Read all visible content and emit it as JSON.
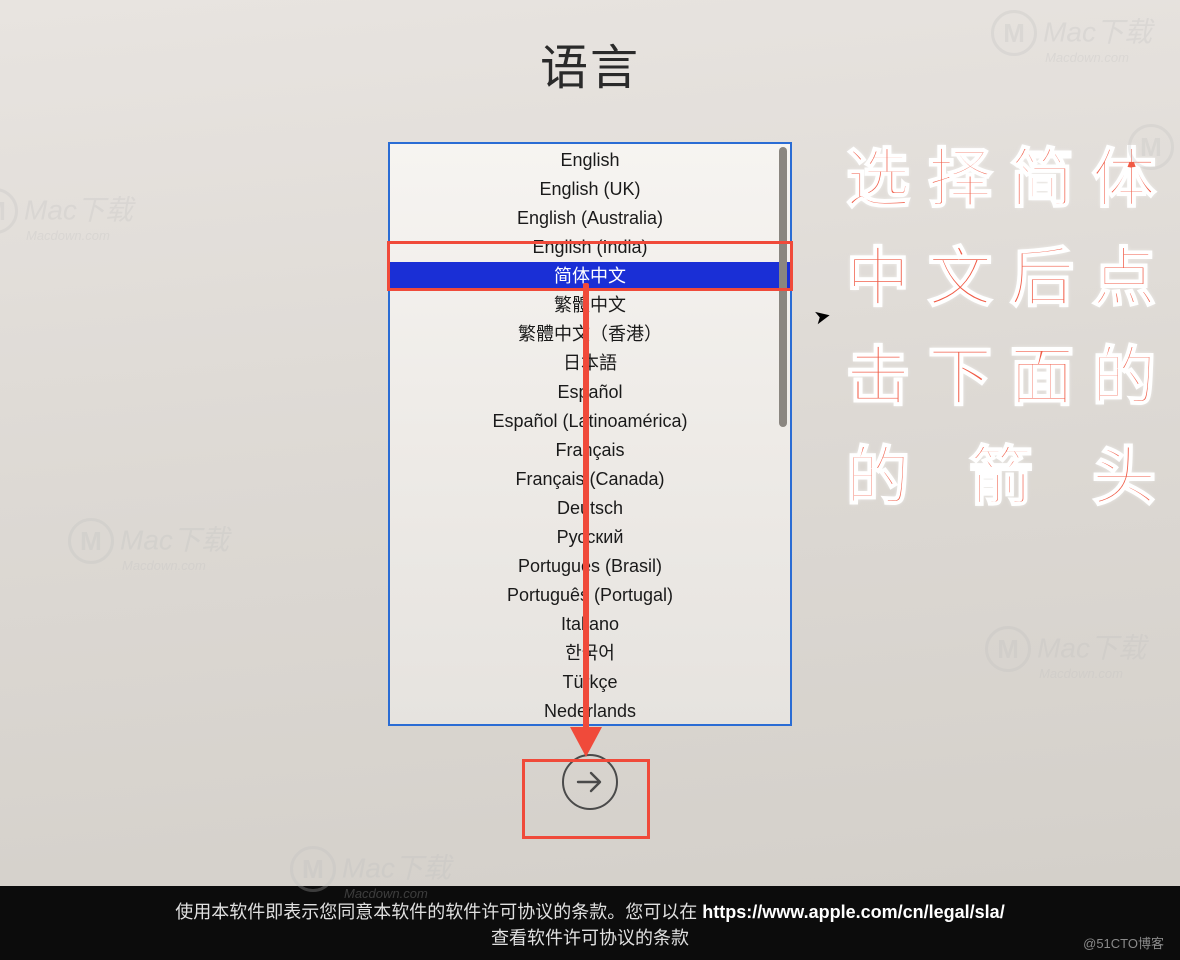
{
  "title": "语言",
  "languages": [
    "English",
    "English (UK)",
    "English (Australia)",
    "English (India)",
    "简体中文",
    "繁體中文",
    "繁體中文（香港）",
    "日本語",
    "Español",
    "Español (Latinoamérica)",
    "Français",
    "Français (Canada)",
    "Deutsch",
    "Русский",
    "Português (Brasil)",
    "Português (Portugal)",
    "Italiano",
    "한국어",
    "Türkçe",
    "Nederlands"
  ],
  "selected_index": 4,
  "callout_lines": [
    "选择简体",
    "中文后点",
    "击下面的",
    "的箭头"
  ],
  "footer": {
    "line1_prefix": "使用本软件即表示您同意本软件的软件许可协议的条款。您可以在 ",
    "line1_bold": "https://www.apple.com/cn/legal/sla/",
    "line2": "查看软件许可协议的条款"
  },
  "watermark": {
    "brand": "Mac下载",
    "site": "Macdown.com"
  },
  "attribution": "@51CTO博客"
}
